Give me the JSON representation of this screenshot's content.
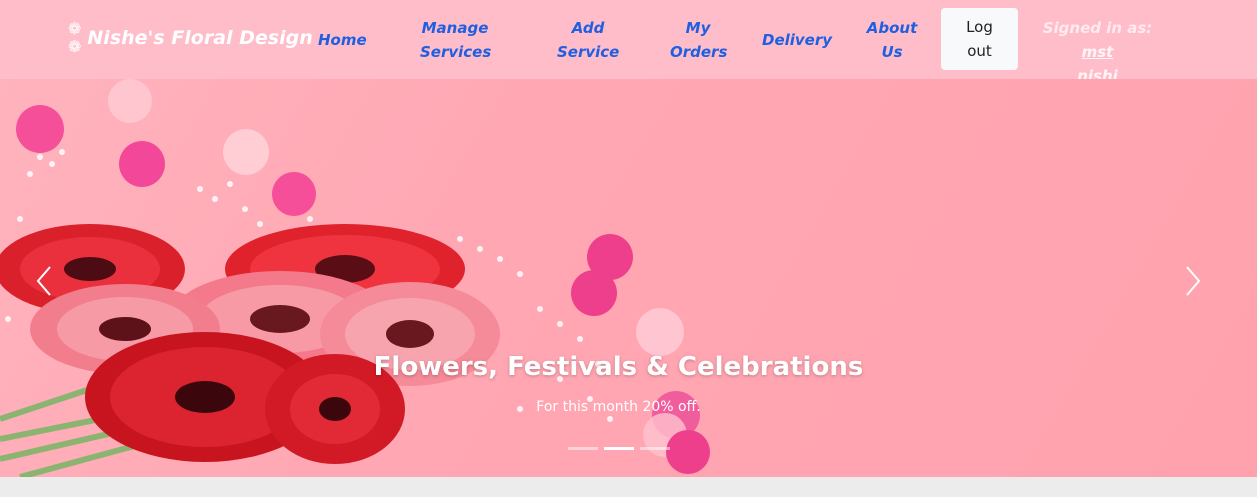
{
  "brand": {
    "name": "Nishe's Floral Design",
    "logo_icon": "flower-icon"
  },
  "nav": {
    "home": "Home",
    "manage_services_1": "Manage",
    "manage_services_2": "Services",
    "add_service_1": "Add",
    "add_service_2": "Service",
    "my_orders_1": "My",
    "my_orders_2": "Orders",
    "delivery": "Delivery",
    "about_1": "About",
    "about_2": "Us",
    "logout_1": "Log",
    "logout_2": "out"
  },
  "user": {
    "signed_in_label": "Signed in as:",
    "name_1": "mst",
    "name_2": "nishi"
  },
  "carousel": {
    "title": "Flowers, Festivals & Celebrations",
    "subtitle": "For this month 20% off.",
    "active_slide": 2,
    "slide_count": 3
  },
  "colors": {
    "navbar": "#ffbdca",
    "nav_link": "#1f5fe0",
    "hero": "#ffa7b3"
  }
}
